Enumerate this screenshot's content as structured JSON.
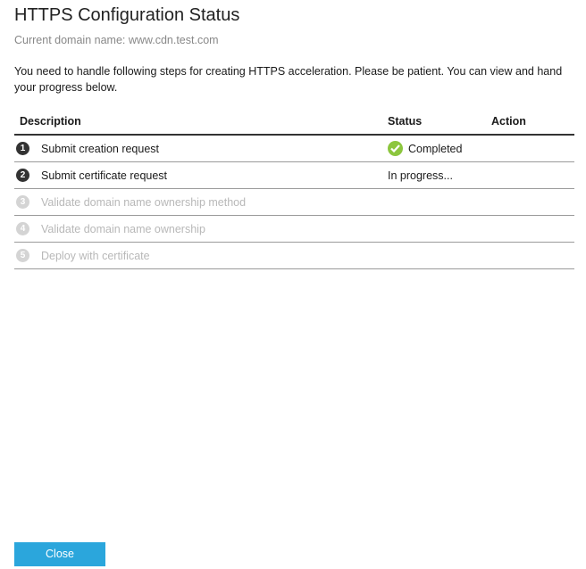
{
  "dialog": {
    "title": "HTTPS Configuration Status",
    "domain_text": "Current domain name: www.cdn.test.com",
    "intro_line1": "You need to handle following steps for creating HTTPS acceleration. Please be patient. You can view and hand",
    "intro_line2": "your progress below."
  },
  "table": {
    "headers": {
      "description": "Description",
      "status": "Status",
      "action": "Action"
    },
    "rows": [
      {
        "num": "1",
        "description": "Submit creation request",
        "status": "Completed",
        "state": "completed"
      },
      {
        "num": "2",
        "description": "Submit certificate request",
        "status": "In progress...",
        "state": "in-progress"
      },
      {
        "num": "3",
        "description": "Validate domain name ownership method",
        "status": "",
        "state": "pending"
      },
      {
        "num": "4",
        "description": "Validate domain name ownership",
        "status": "",
        "state": "pending"
      },
      {
        "num": "5",
        "description": "Deploy with certificate",
        "status": "",
        "state": "pending"
      }
    ]
  },
  "footer": {
    "close_label": "Close"
  },
  "colors": {
    "accent": "#2ba6dc",
    "success": "#8cc63e",
    "step_active": "#333333",
    "step_disabled": "#d4d4d4"
  },
  "icons": {
    "completed": "check-circle-icon"
  }
}
